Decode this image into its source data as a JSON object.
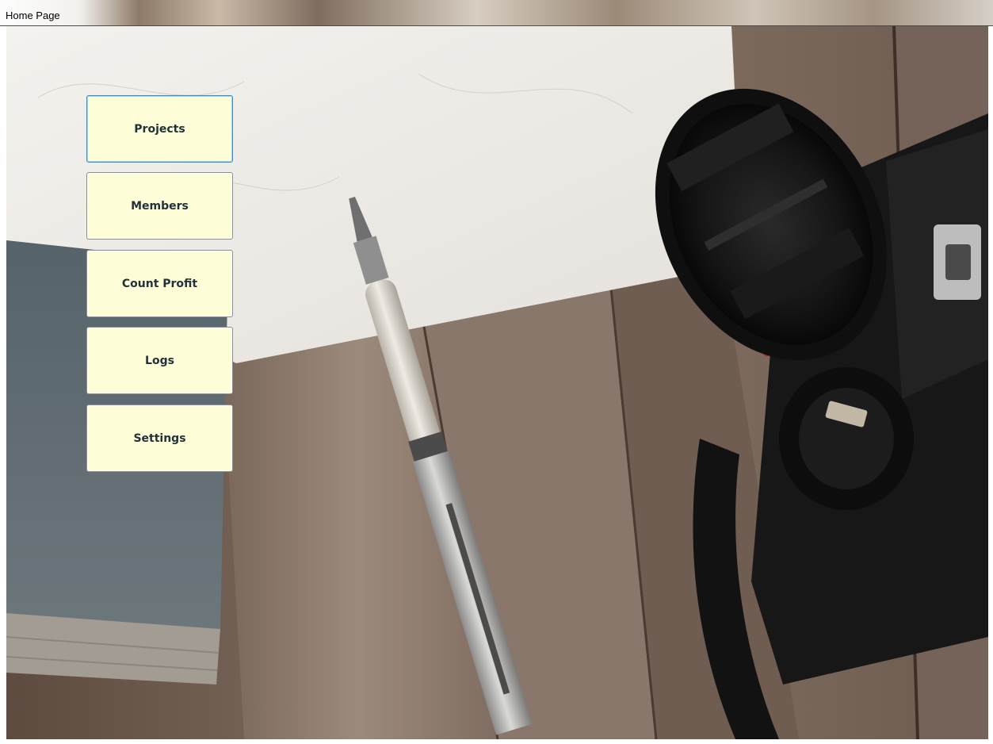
{
  "window": {
    "title": "Home Page"
  },
  "menu": {
    "items": [
      {
        "label": "Projects",
        "focused": true
      },
      {
        "label": "Members",
        "focused": false
      },
      {
        "label": "Count Profit",
        "focused": false
      },
      {
        "label": "Logs",
        "focused": false
      },
      {
        "label": "Settings",
        "focused": false
      }
    ]
  },
  "theme": {
    "button_background": "#fdfdd8",
    "button_text": "#23323a",
    "focus_border": "#3c8fc7"
  }
}
